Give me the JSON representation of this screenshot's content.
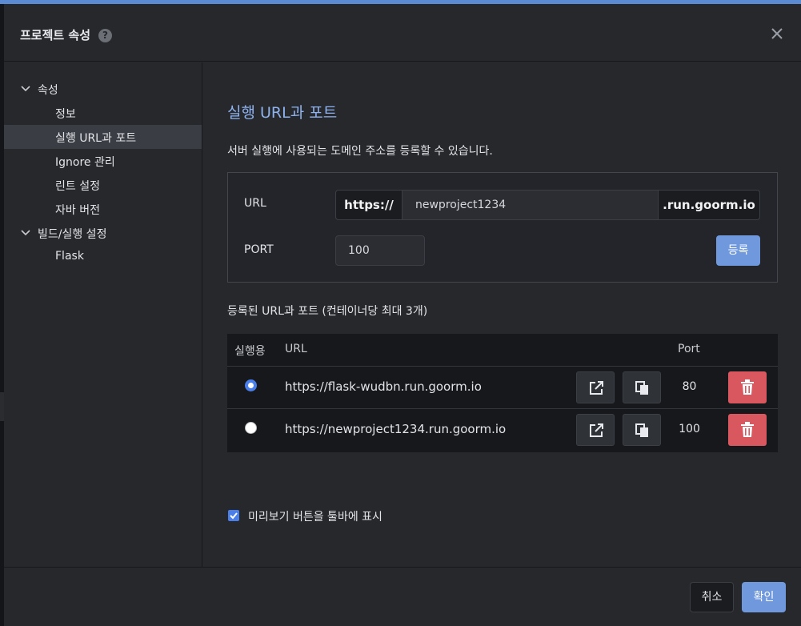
{
  "dialog": {
    "title": "프로젝트 속성",
    "help_icon": "question-circle-icon",
    "close_icon": "close-icon"
  },
  "sidebar": {
    "groups": [
      {
        "label": "속성",
        "expanded": true,
        "items": [
          {
            "label": "정보"
          },
          {
            "label": "실행 URL과 포트",
            "active": true
          },
          {
            "label": "Ignore 관리"
          },
          {
            "label": "린트 설정"
          },
          {
            "label": "자바 버전"
          }
        ]
      },
      {
        "label": "빌드/실행 설정",
        "expanded": true,
        "items": [
          {
            "label": "Flask"
          }
        ]
      }
    ]
  },
  "main": {
    "title": "실행 URL과 포트",
    "description": "서버 실행에 사용되는 도메인 주소를 등록할 수 있습니다.",
    "form": {
      "url_label": "URL",
      "url_prefix": "https://",
      "url_value": "newproject1234",
      "url_suffix": ".run.goorm.io",
      "port_label": "PORT",
      "port_value": "100",
      "register_label": "등록"
    },
    "registered_title": "등록된 URL과 포트 (컨테이너당 최대 3개)",
    "table": {
      "headers": {
        "run": "실행용",
        "url": "URL",
        "port": "Port"
      },
      "rows": [
        {
          "url": "https://flask-wudbn.run.goorm.io",
          "port": "80",
          "selected": true
        },
        {
          "url": "https://newproject1234.run.goorm.io",
          "port": "100",
          "selected": false
        }
      ]
    },
    "preview_toggle": {
      "label": "미리보기 버튼을 툴바에 표시",
      "checked": true
    }
  },
  "footer": {
    "cancel_label": "취소",
    "ok_label": "확인"
  },
  "colors": {
    "accent": "#6f99dc",
    "title": "#8fb3f0",
    "danger": "#d9575f",
    "radio_checked": "#4a7ee8"
  }
}
